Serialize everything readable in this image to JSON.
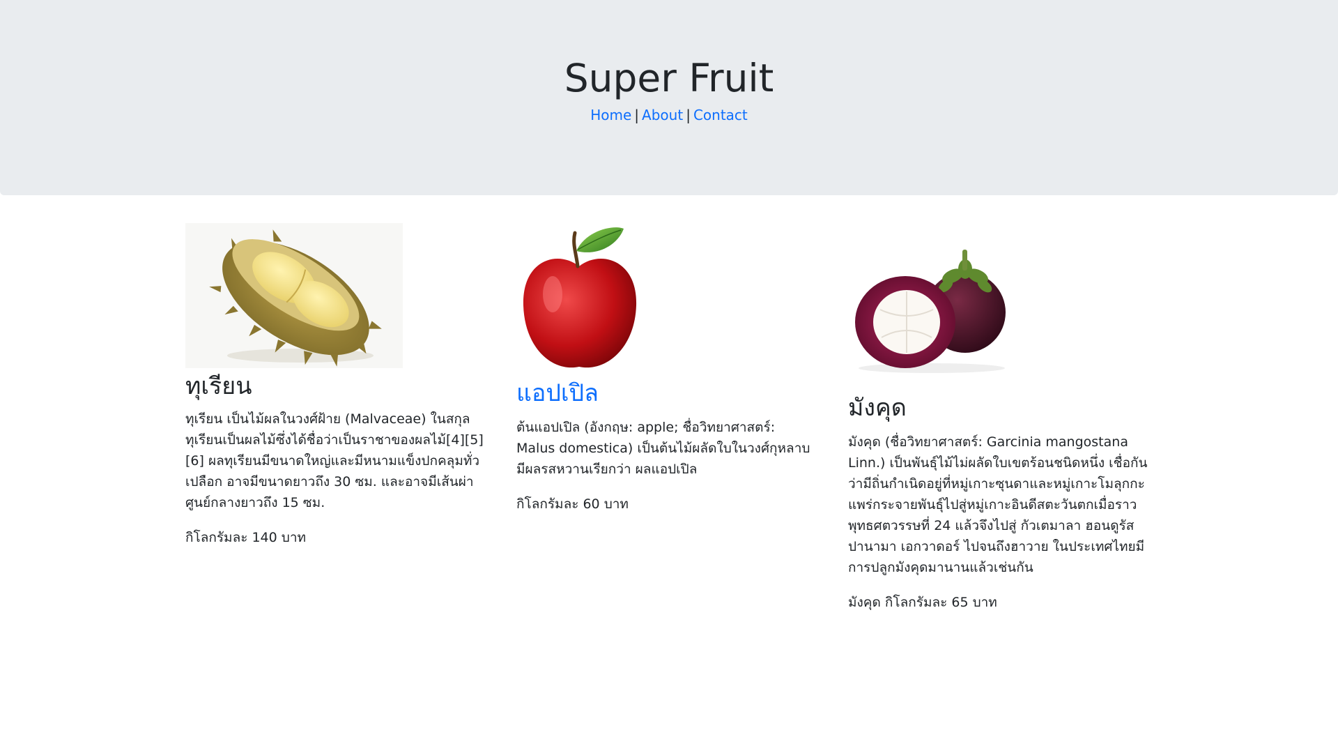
{
  "header": {
    "title": "Super Fruit",
    "nav": [
      {
        "label": "Home"
      },
      {
        "label": "About"
      },
      {
        "label": "Contact"
      }
    ],
    "separator": "|"
  },
  "fruits": [
    {
      "name": "ทุเรียน",
      "image_icon": "durian-image",
      "description": "ทุเรียน เป็นไม้ผลในวงศ์ฝ้าย (Malvaceae) ในสกุลทุเรียนเป็นผลไม้ซึ่งได้ชื่อว่าเป็นราชาของผลไม้[4][5][6] ผลทุเรียนมีขนาดใหญ่และมีหนามแข็งปกคลุมทั่วเปลือก อาจมีขนาดยาวถึง 30 ซม. และอาจมีเส้นผ่าศูนย์กลางยาวถึง 15 ซม.",
      "price": "กิโลกรัมละ 140 บาท"
    },
    {
      "name": "แอปเปิล",
      "image_icon": "apple-image",
      "description": "ต้นแอปเปิล (อังกฤษ: apple; ชื่อวิทยาศาสตร์: Malus domestica) เป็นต้นไม้ผลัดใบในวงศ์กุหลาบ มีผลรสหวานเรียกว่า ผลแอปเปิล",
      "price": "กิโลกรัมละ 60 บาท"
    },
    {
      "name": "มังคุด",
      "image_icon": "mangosteen-image",
      "description": "มังคุด (ชื่อวิทยาศาสตร์: Garcinia mangostana Linn.) เป็นพันธุ์ไม้ไม่ผลัดใบเขตร้อนชนิดหนึ่ง เชื่อกันว่ามีถิ่นกำเนิดอยู่ที่หมู่เกาะซุนดาและหมู่เกาะโมลุกกะ แพร่กระจายพันธุ์ไปสู่หมู่เกาะอินดีสตะวันตกเมื่อราวพุทธศตวรรษที่ 24 แล้วจึงไปสู่ กัวเตมาลา ฮอนดูรัส ปานามา เอกวาดอร์ ไปจนถึงฮาวาย ในประเทศไทยมีการปลูกมังคุดมานานแล้วเช่นกัน",
      "price": "มังคุด กิโลกรัมละ 65 บาท"
    }
  ],
  "colors": {
    "hero_background": "#e9ecef",
    "link": "#0d6efd",
    "text": "#212529"
  }
}
